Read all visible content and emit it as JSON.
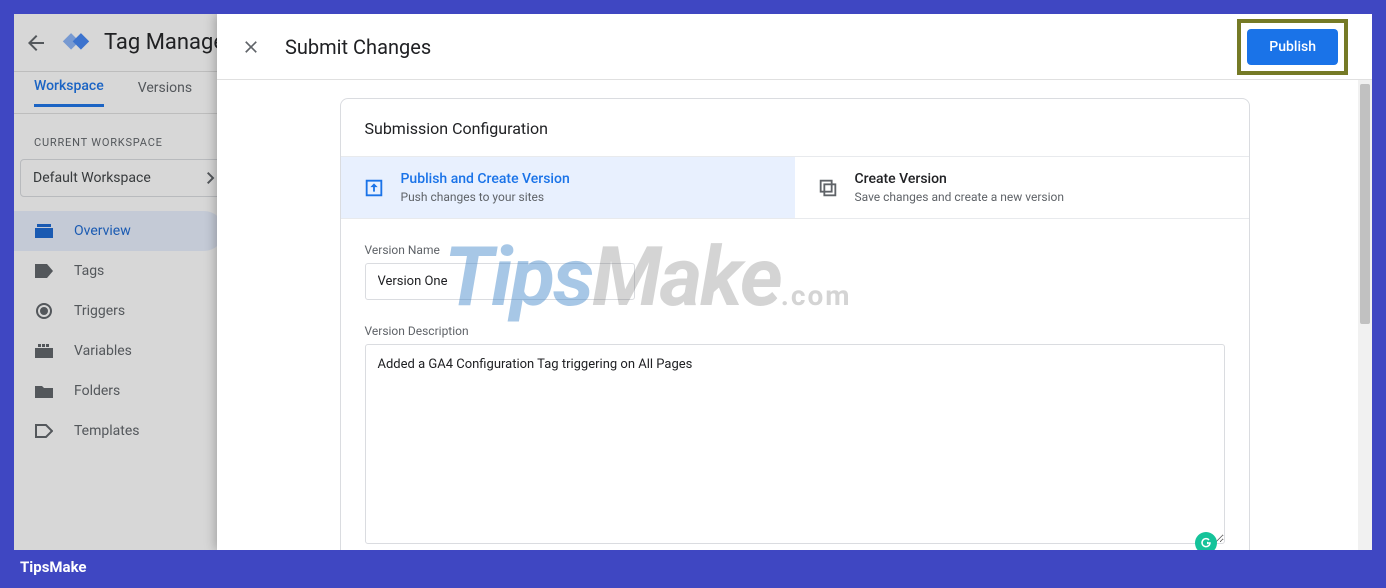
{
  "bg": {
    "title": "Tag Manage",
    "tabs": {
      "workspace": "Workspace",
      "versions": "Versions"
    },
    "current_workspace_label": "CURRENT WORKSPACE",
    "current_workspace": "Default Workspace",
    "nav": {
      "overview": "Overview",
      "tags": "Tags",
      "triggers": "Triggers",
      "variables": "Variables",
      "folders": "Folders",
      "templates": "Templates"
    }
  },
  "modal": {
    "title": "Submit Changes",
    "publish_btn": "Publish",
    "card_title": "Submission Configuration",
    "option_publish": {
      "title": "Publish and Create Version",
      "sub": "Push changes to your sites"
    },
    "option_create": {
      "title": "Create Version",
      "sub": "Save changes and create a new version"
    },
    "version_name_label": "Version Name",
    "version_name_value": "Version One",
    "version_desc_label": "Version Description",
    "version_desc_value": "Added a GA4 Configuration Tag triggering on All Pages"
  },
  "watermark": {
    "tips": "Tips",
    "make": "Make",
    "com": ".com"
  },
  "footer": "TipsMake"
}
